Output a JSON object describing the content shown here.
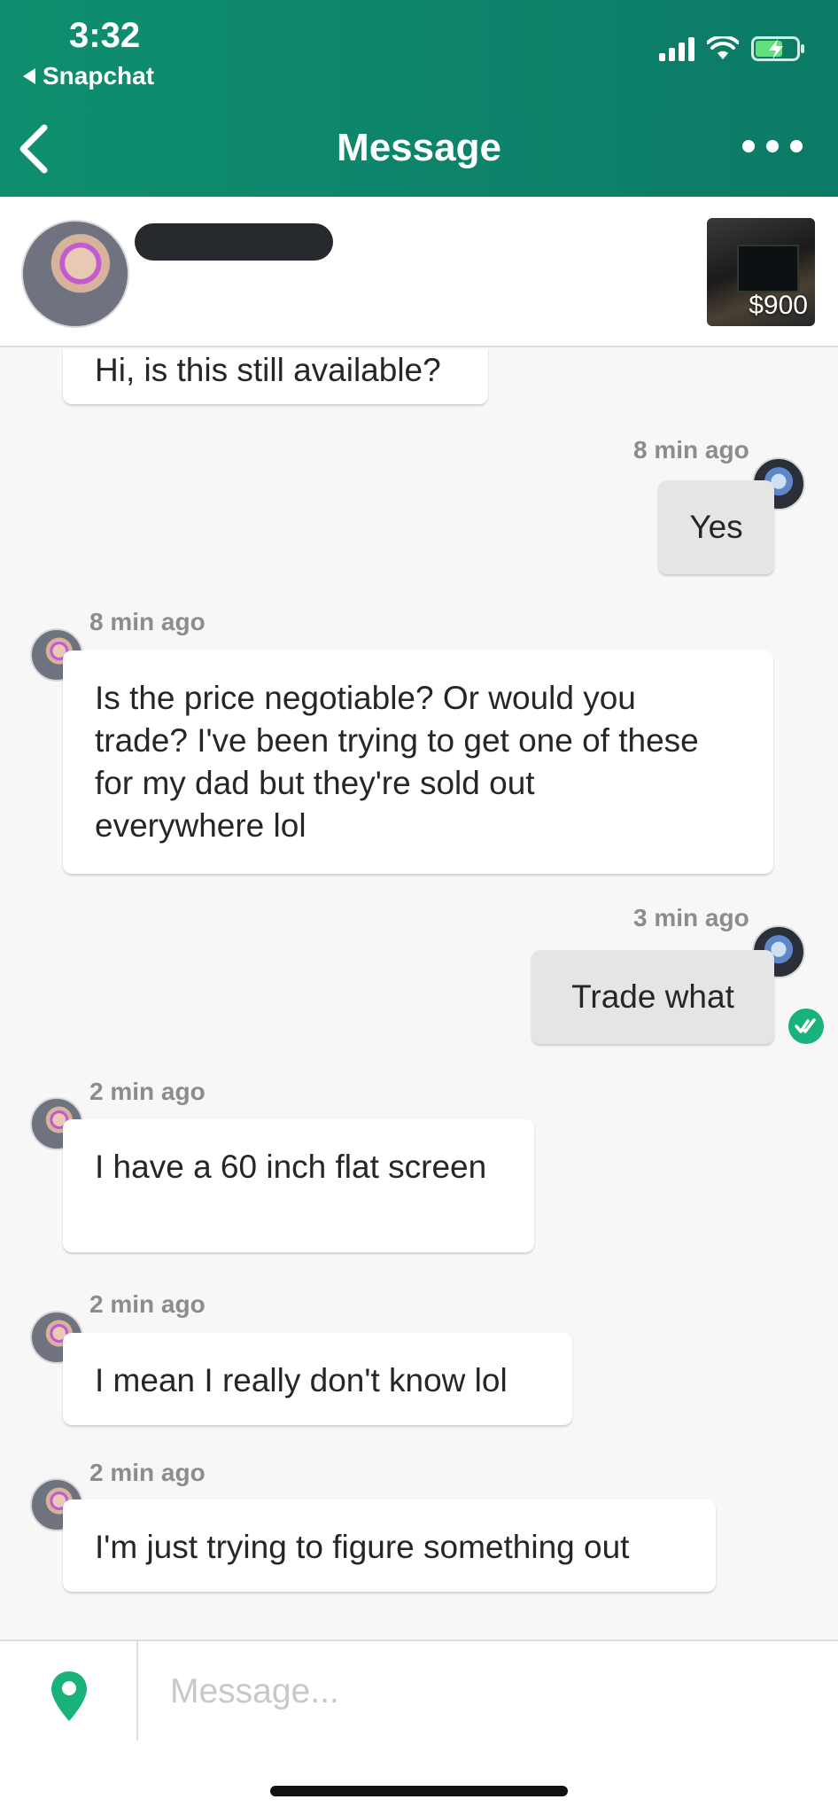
{
  "status_bar": {
    "time": "3:32",
    "back_app_label": "Snapchat",
    "icons": [
      "cellular-signal-icon",
      "wifi-icon",
      "battery-charging-icon"
    ]
  },
  "nav": {
    "title": "Message",
    "back_icon": "chevron-left-icon",
    "more_icon": "more-horizontal-icon"
  },
  "listing": {
    "price": "$900",
    "seller_name_redacted": true
  },
  "messages": [
    {
      "from": "seller",
      "text": "Hi, is this still available?"
    },
    {
      "from": "me",
      "timestamp": "8 min ago",
      "text": "Yes"
    },
    {
      "from": "seller",
      "timestamp": "8 min ago",
      "lines": [
        "Is the price negotiable? Or would you",
        "trade? I've been trying to get one of these",
        "for my dad but they're sold out",
        "everywhere lol"
      ]
    },
    {
      "from": "me",
      "timestamp": "3 min ago",
      "text": "Trade what",
      "read": true
    },
    {
      "from": "seller",
      "timestamp": "2 min ago",
      "text": "I have a 60 inch flat screen"
    },
    {
      "from": "seller",
      "timestamp": "2 min ago",
      "text": "I mean I really don't know lol"
    },
    {
      "from": "seller",
      "timestamp": "2 min ago",
      "text": "I'm just trying to figure something out"
    }
  ],
  "composer": {
    "placeholder": "Message...",
    "value": "",
    "location_icon": "location-pin-icon"
  },
  "colors": {
    "header": "#0f8f6f",
    "accent": "#18b27a",
    "incoming_bubble": "#ffffff",
    "outgoing_bubble": "#e5e5e5"
  }
}
